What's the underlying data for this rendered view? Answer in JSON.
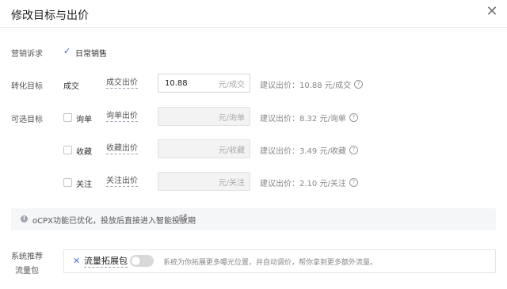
{
  "dialog": {
    "title": "修改目标与出价",
    "close_icon": "close-icon"
  },
  "appeal": {
    "label": "营销诉求",
    "value": "日常销售",
    "check": "✓"
  },
  "conversion": {
    "label": "转化目标",
    "goal": "成交",
    "price_label": "成交出价",
    "value": "10.88",
    "unit": "元/成交",
    "suggest": "建议出价：10.88 元/成交"
  },
  "optional": {
    "label": "可选目标",
    "items": [
      {
        "goal": "询单",
        "price_label": "询单出价",
        "unit": "元/询单",
        "suggest": "建议出价：8.32 元/询单"
      },
      {
        "goal": "收藏",
        "price_label": "收藏出价",
        "unit": "元/收藏",
        "suggest": "建议出价：3.49 元/收藏"
      },
      {
        "goal": "关注",
        "price_label": "关注出价",
        "unit": "元/关注",
        "suggest": "建议出价：2.10 元/关注"
      }
    ]
  },
  "info": {
    "text": "oCPX功能已优化，投放后直接进入",
    "link": "智能投放期"
  },
  "traffic": {
    "label_line1": "系统推荐",
    "label_line2": "流量包",
    "package_name": "流量拓展包",
    "toggle_on": false,
    "description": "系统为你拓展更多曝光位置，并自动调价，帮你拿到更多额外流量。"
  }
}
